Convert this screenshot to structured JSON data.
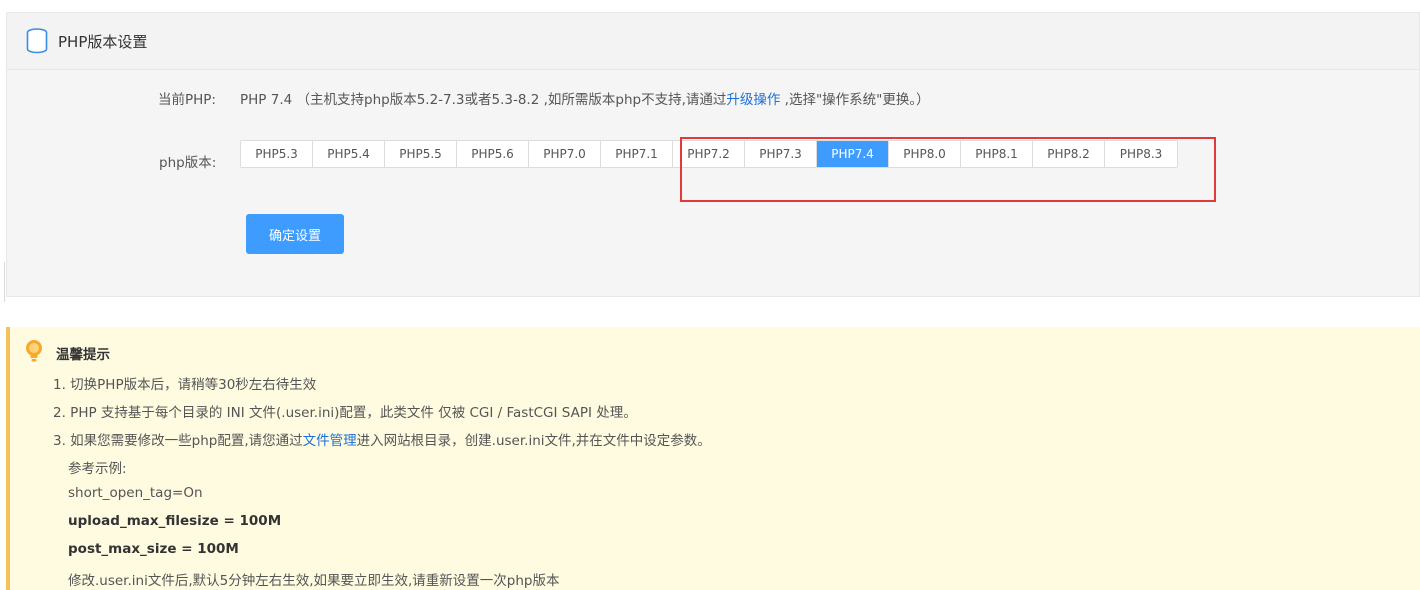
{
  "header": {
    "title": "PHP版本设置",
    "icon": "database-icon"
  },
  "current": {
    "label": "当前PHP:",
    "version": "PHP 7.4",
    "note_prefix": "（主机支持php版本5.2-7.3或者5.3-8.2 ,如所需版本php不支持,请通过",
    "upgrade_link": "升级操作",
    "note_suffix": " ,选择\"操作系统\"更换。）"
  },
  "version_selector": {
    "label": "php版本:",
    "options": [
      "PHP5.3",
      "PHP5.4",
      "PHP5.5",
      "PHP5.6",
      "PHP7.0",
      "PHP7.1",
      "PHP7.2",
      "PHP7.3",
      "PHP7.4",
      "PHP8.0",
      "PHP8.1",
      "PHP8.2",
      "PHP8.3"
    ],
    "selected": "PHP7.4"
  },
  "confirm_label": "确定设置",
  "tips": {
    "title": "温馨提示",
    "line1": "1. 切换PHP版本后，请稍等30秒左右待生效",
    "line2": "2. PHP 支持基于每个目录的 INI 文件(.user.ini)配置，此类文件 仅被 CGI / FastCGI SAPI 处理。",
    "line3_prefix": "3. 如果您需要修改一些php配置,请您通过",
    "line3_link": "文件管理",
    "line3_suffix": "进入网站根目录，创建.user.ini文件,并在文件中设定参数。",
    "example_label": "参考示例:",
    "ex1": "short_open_tag=On",
    "ex2_key": "upload_max_filesize",
    "ex2_val": " = 100M",
    "ex3_key": "post_max_size",
    "ex3_val": " = 100M",
    "footer": "修改.user.ini文件后,默认5分钟左右生效,如果要立即生效,请重新设置一次php版本"
  },
  "colors": {
    "accent": "#3f9cff",
    "link": "#1e6fd9",
    "highlight": "#e23a3a",
    "tips_bg": "#fefbe0",
    "tips_border": "#f4c15a"
  }
}
